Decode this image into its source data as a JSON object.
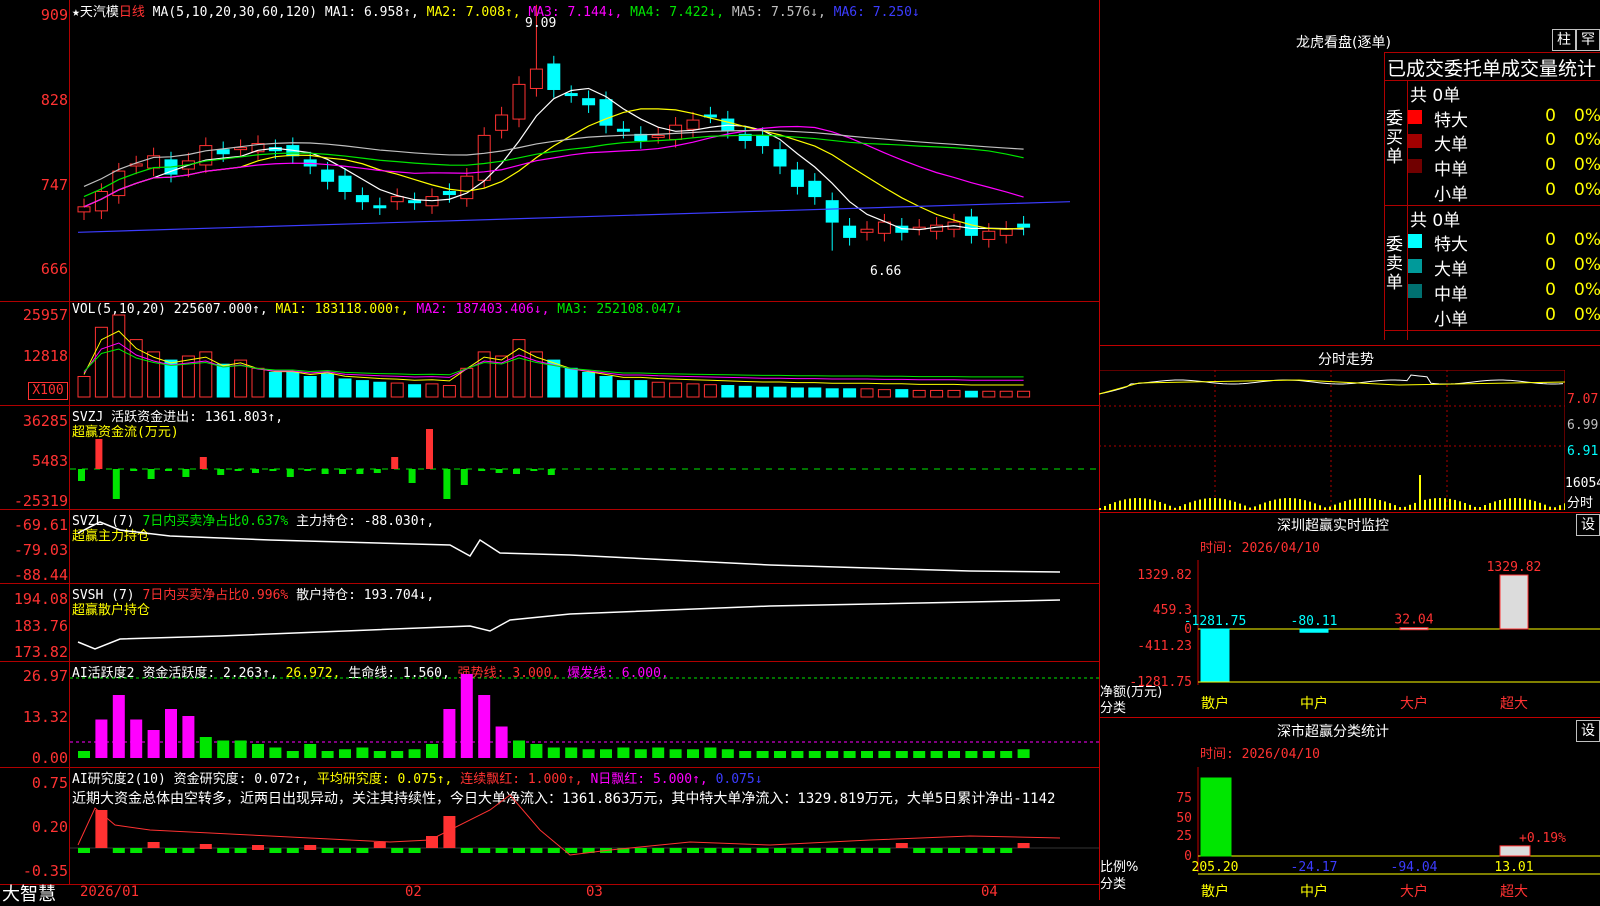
{
  "colors": {
    "up": "#ff3232",
    "down": "#00ffff",
    "ma1": "#ffffff",
    "ma2": "#ffff00",
    "ma3": "#ff00ff",
    "ma4": "#00e600",
    "ma5": "#c0c0c0",
    "ma6": "#3c3cff"
  },
  "main": {
    "title": "★天汽模",
    "period": "日线",
    "ma_label": "MA(5,10,20,30,60,120)",
    "ma1": "MA1: 6.958↑,",
    "ma2": "MA2: 7.008↑,",
    "ma3": "MA3: 7.144↓,",
    "ma4": "MA4: 7.422↓,",
    "ma5": "MA5: 7.576↓,",
    "ma6": "MA6: 7.250↓",
    "high_mark": "9.09",
    "low_mark": "6.66",
    "axis": [
      "909",
      "828",
      "747",
      "666"
    ]
  },
  "vol": {
    "label": "VOL(5,10,20)",
    "value": "225607.000↑,",
    "ma1": "MA1: 183118.000↑,",
    "ma2": "MA2: 187403.406↓,",
    "ma3": "MA3: 252108.047↓",
    "axis": [
      "25957",
      "12818"
    ],
    "unit": "X100"
  },
  "svzj": {
    "label": "SVZJ",
    "desc": "活跃资金进出: 1361.803↑,",
    "sub": "超赢资金流(万元)",
    "axis": [
      "36285",
      "5483",
      "-25319"
    ]
  },
  "svzl": {
    "label": "SVZL (7)",
    "desc1": "7日内买卖净占比0.637%",
    "desc2": "主力持仓: -88.030↑,",
    "sub": "超赢主力持仓",
    "axis": [
      "-69.61",
      "-79.03",
      "-88.44"
    ]
  },
  "svsh": {
    "label": "SVSH (7)",
    "desc1": "7日内买卖净占比0.996%",
    "desc2": "散户持仓: 193.704↓,",
    "sub": "超赢散户持仓",
    "axis": [
      "194.08",
      "183.76",
      "173.82"
    ]
  },
  "ai1": {
    "label": "AI活跃度2",
    "d1": "资金活跃度: 2.263↑,",
    "d2": "26.972,",
    "d3": "生命线: 1.560,",
    "d4": "强势线: 3.000,",
    "d5": "爆发线: 6.000,",
    "axis": [
      "26.97",
      "13.32",
      "0.00"
    ]
  },
  "ai2": {
    "label": "AI研究度2(10)",
    "d1": "资金研究度: 0.072↑,",
    "d2": "平均研究度: 0.075↑,",
    "d3": "连续飘红: 1.000↑,",
    "d4": "N日飘红: 5.000↑,",
    "d5": "0.075↓",
    "commentary": "近期大资金总体由空转多，近两日出现异动，关注其持续性，今日大单净流入：1361.863万元，其中特大单净流入：1329.819万元，大单5日累计净出-1142",
    "axis": [
      "0.75",
      "0.20",
      "-0.35"
    ]
  },
  "xaxis": {
    "logo": "大智慧",
    "labels": [
      "2026/01",
      "02",
      "03",
      "04"
    ]
  },
  "dragon": {
    "title": "龙虎看盘(逐单)",
    "btn1": "柱",
    "btn2": "罕",
    "heading": "已成交委托单成交量统计",
    "buy_label": "委买单",
    "sell_label": "委卖单",
    "buy_total": "共 0单",
    "sell_total": "共 0单",
    "rows": [
      {
        "label": "特大",
        "v": "0",
        "p": "0%"
      },
      {
        "label": "大单",
        "v": "0",
        "p": "0%"
      },
      {
        "label": "中单",
        "v": "0",
        "p": "0%"
      },
      {
        "label": "小单",
        "v": "0",
        "p": "0%"
      }
    ]
  },
  "intraday": {
    "title": "分时走势",
    "axis": [
      "7.07",
      "6.99",
      "6.91",
      "16054"
    ],
    "axis_label": "分时"
  },
  "monitor": {
    "title": "深圳超赢实时监控",
    "btn": "设",
    "time": "时间: 2026/04/10",
    "axis": [
      "1329.82",
      "459.3",
      "0",
      "-411.23",
      "-1281.75"
    ],
    "unit": "净额(万元)",
    "cat_label": "分类",
    "bars": [
      {
        "cat": "散户",
        "value": -1281.75,
        "label": "-1281.75"
      },
      {
        "cat": "中户",
        "value": -80.11,
        "label": "-80.11"
      },
      {
        "cat": "大户",
        "value": 32.04,
        "label": "32.04"
      },
      {
        "cat": "超大",
        "value": 1329.82,
        "label": "1329.82"
      }
    ]
  },
  "classify": {
    "title": "深市超赢分类统计",
    "btn": "设",
    "time": "时间: 2026/04/10",
    "axis": [
      "75",
      "50",
      "25",
      "0"
    ],
    "unit": "比例%",
    "cat_label": "分类",
    "annot": "+0.19%",
    "bars": [
      {
        "cat": "散户",
        "value": 205.2,
        "label": "205.20"
      },
      {
        "cat": "中户",
        "value": -24.17,
        "label": "-24.17"
      },
      {
        "cat": "大户",
        "value": -94.04,
        "label": "-94.04"
      },
      {
        "cat": "超大",
        "value": 13.01,
        "label": "13.01"
      }
    ]
  }
}
